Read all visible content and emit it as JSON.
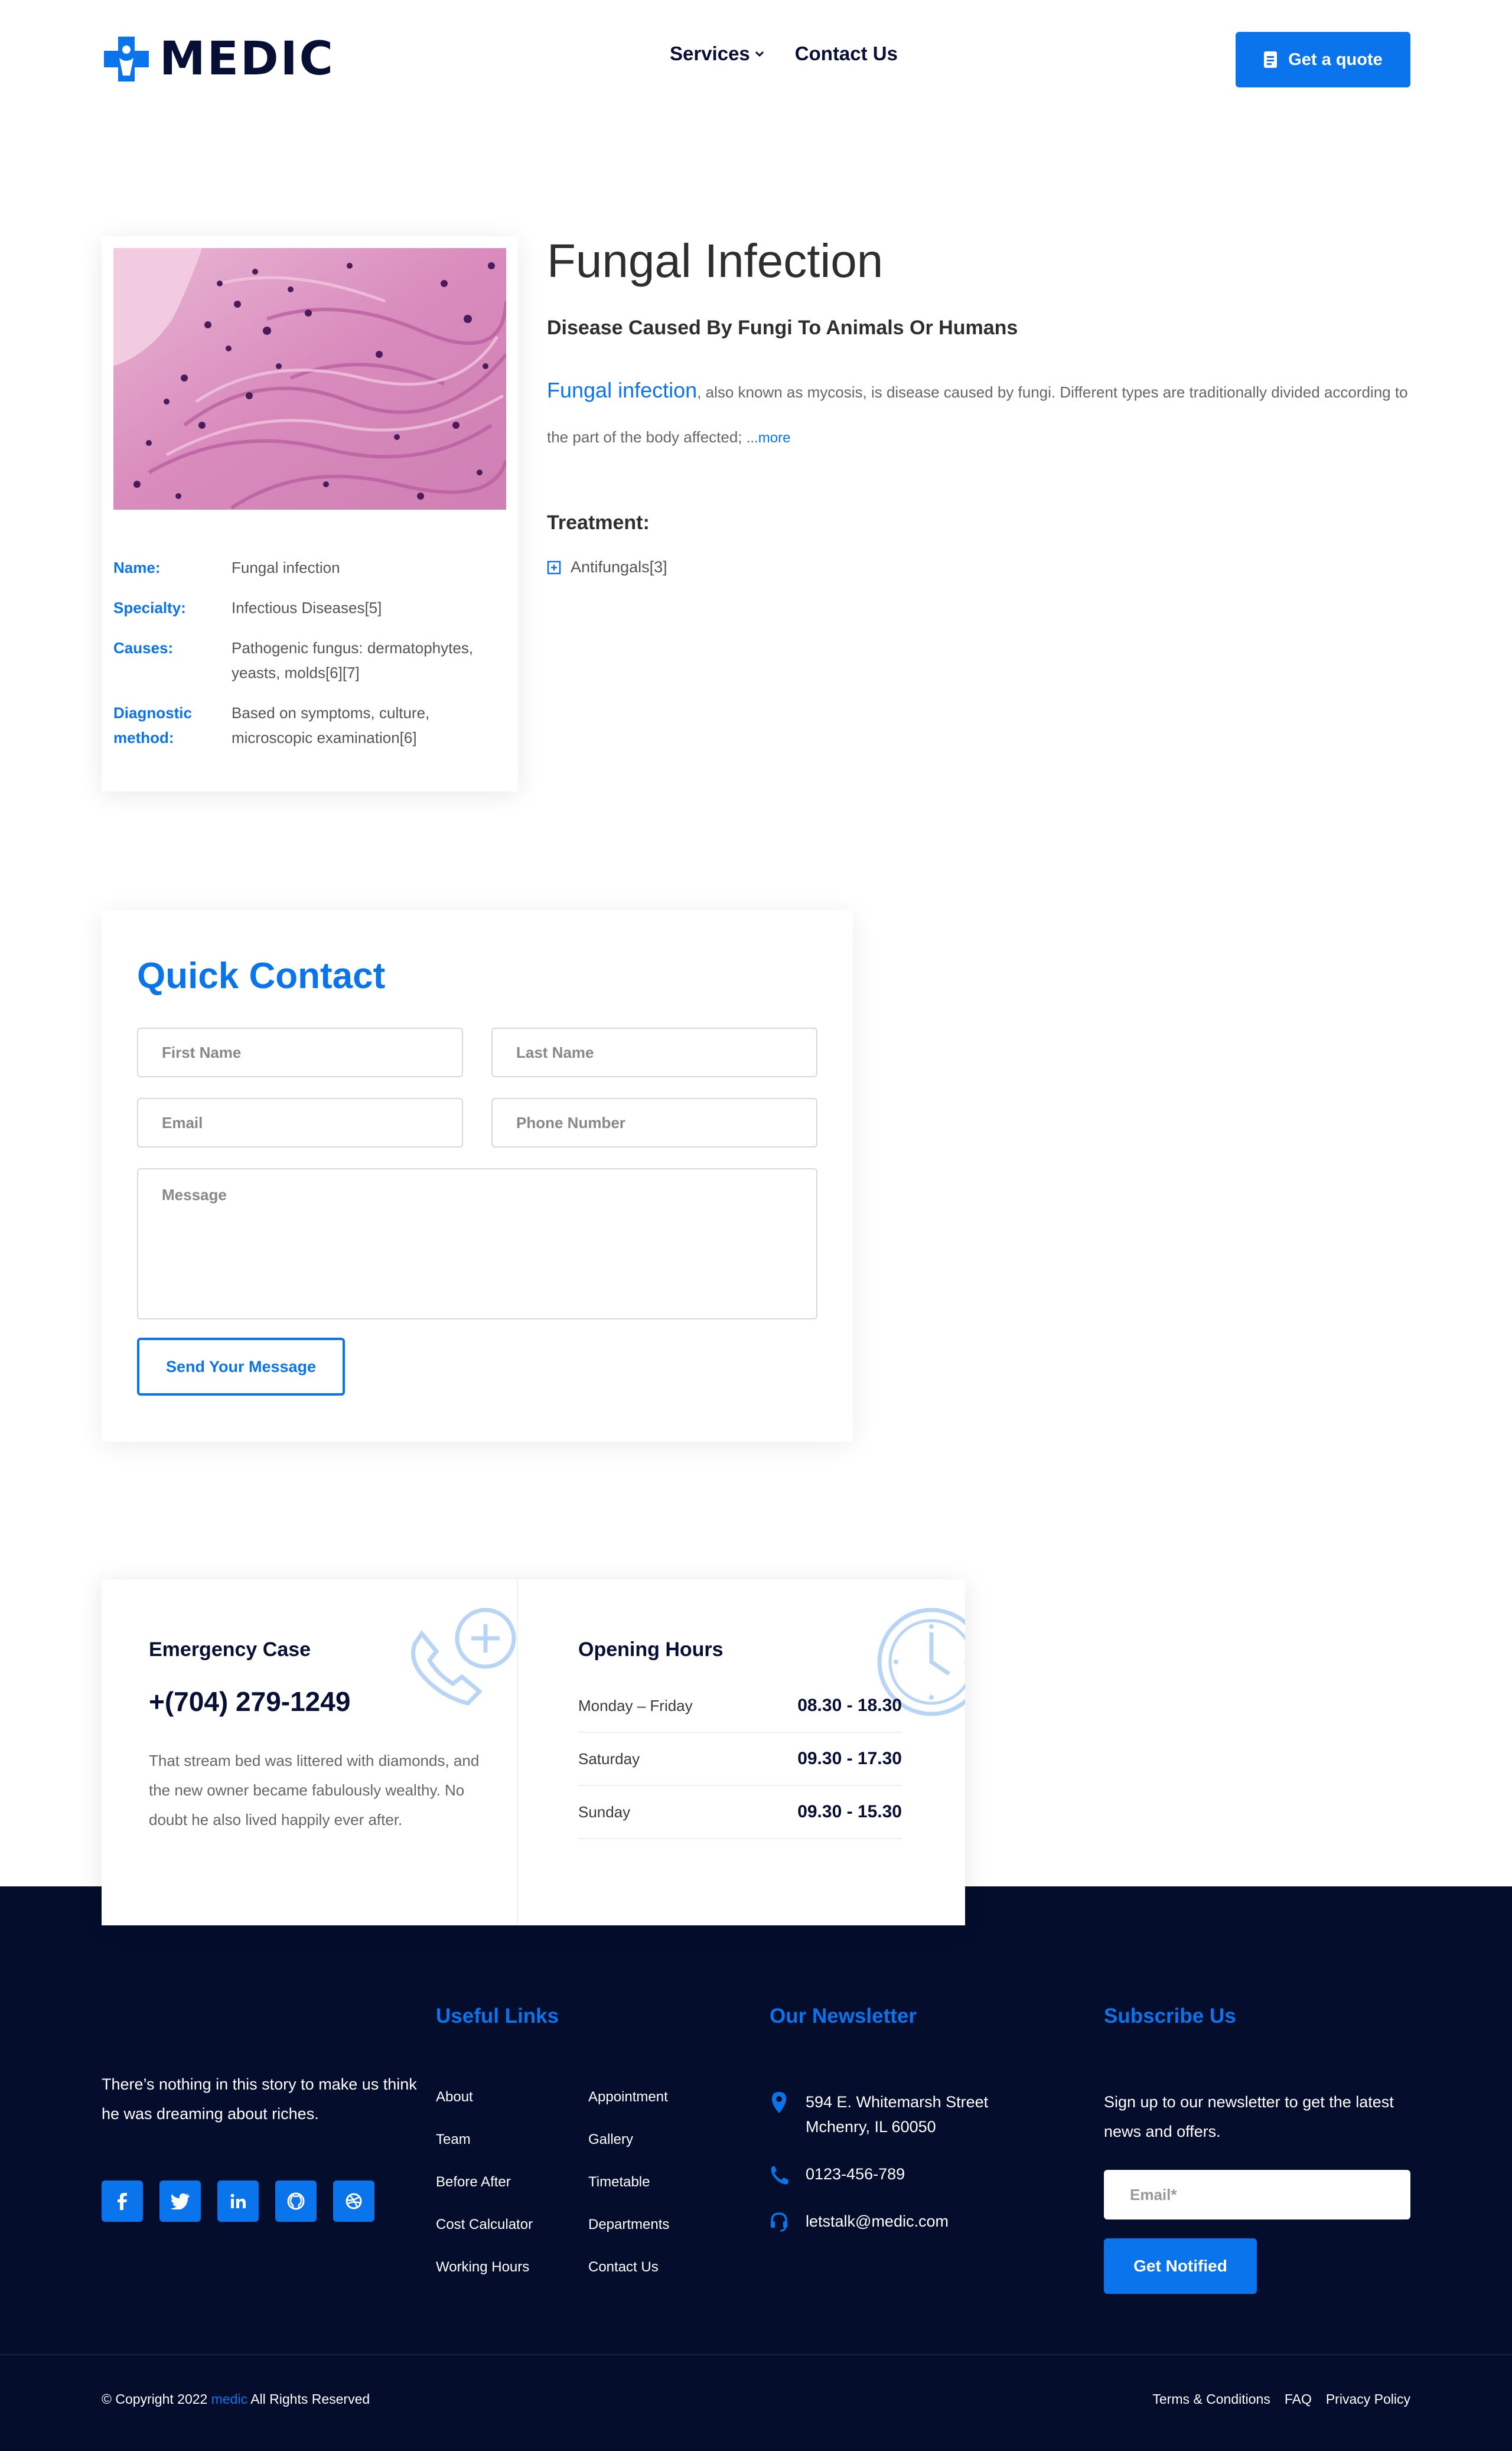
{
  "header": {
    "logo_text": "MEDIC",
    "nav": [
      {
        "label": "Services",
        "has_dropdown": true
      },
      {
        "label": "Contact Us",
        "has_dropdown": false
      }
    ],
    "quote_button": "Get a quote"
  },
  "info_card": {
    "rows": [
      {
        "key": "Name:",
        "value": "Fungal infection"
      },
      {
        "key": "Specialty:",
        "value": "Infectious Diseases[5]"
      },
      {
        "key": "Causes:",
        "value": "Pathogenic fungus: dermatophytes, yeasts, molds[6][7]"
      },
      {
        "key": "Diagnostic method:",
        "value": "Based on symptoms, culture, microscopic examination[6]"
      }
    ]
  },
  "article": {
    "title": "Fungal Infection",
    "subtitle": "Disease Caused By Fungi To Animals Or Humans",
    "link_text": "Fungal infection",
    "body": ", also known as mycosis, is disease caused by fungi. Different types are traditionally divided according to the part of the body affected; ",
    "more": "...more",
    "treatment_heading": "Treatment:",
    "treatment_item": "Antifungals[3]"
  },
  "quick_contact": {
    "title": "Quick Contact",
    "first_name": "First Name",
    "last_name": "Last Name",
    "email": "Email",
    "phone": "Phone Number",
    "message": "Message",
    "submit": "Send Your Message"
  },
  "emergency": {
    "title": "Emergency Case",
    "phone": "+(704) 279-1249",
    "text": "That stream bed was littered with diamonds, and the new owner became fabulously wealthy. No doubt he also lived happily ever after."
  },
  "hours": {
    "title": "Opening Hours",
    "rows": [
      {
        "day": "Monday – Friday",
        "time": "08.30 - 18.30"
      },
      {
        "day": "Saturday",
        "time": "09.30 - 17.30"
      },
      {
        "day": "Sunday",
        "time": "09.30 - 15.30"
      }
    ]
  },
  "footer": {
    "about": "There’s nothing in this story to make us think he was dreaming about riches.",
    "social_icons": [
      "facebook-icon",
      "twitter-icon",
      "linkedin-icon",
      "github-icon",
      "dribbble-icon"
    ],
    "useful_links_title": "Useful Links",
    "useful_links": [
      "About",
      "Appointment",
      "Team",
      "Gallery",
      "Before After",
      "Timetable",
      "Cost Calculator",
      "Departments",
      "Working Hours",
      "Contact Us"
    ],
    "newsletter_title": "Our Newsletter",
    "address": "594 E. Whitemarsh Street Mchenry, IL 60050",
    "phone": "0123-456-789",
    "email": "letstalk@medic.com",
    "subscribe_title": "Subscribe Us",
    "subscribe_text": "Sign up to our newsletter to get the latest news and offers.",
    "email_placeholder": "Email*",
    "notify_button": "Get Notified",
    "copyright_prefix": "© Copyright 2022 ",
    "copyright_brand": "medic",
    "copyright_suffix": " All Rights Reserved",
    "bottom_links": [
      "Terms & Conditions",
      "FAQ",
      "Privacy Policy"
    ]
  },
  "colors": {
    "accent": "#0a74ed",
    "navy": "#071034",
    "footer_bg": "#040d2b"
  }
}
